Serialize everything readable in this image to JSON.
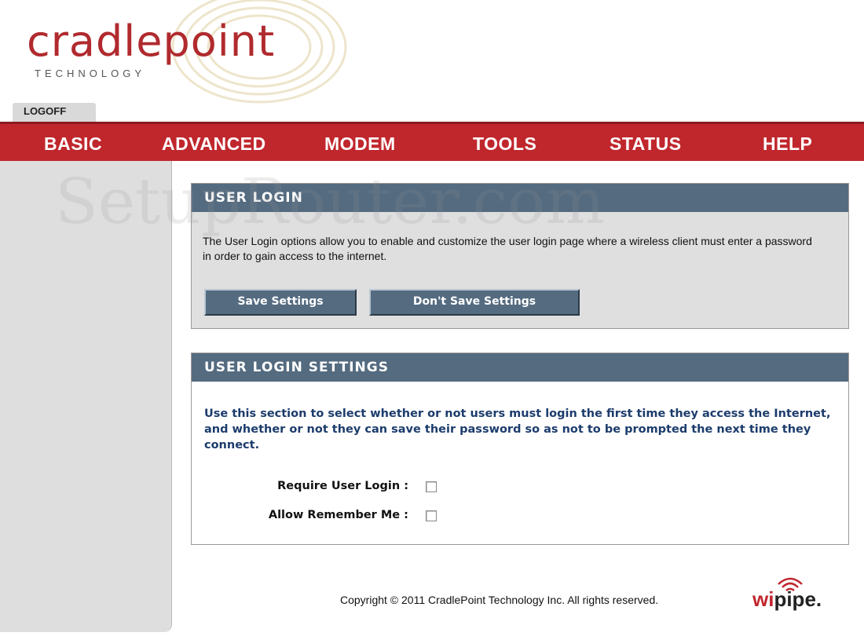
{
  "brand": {
    "name": "cradlepoint",
    "subtitle": "TECHNOLOGY",
    "accent_color": "#c0272d",
    "watermark": "SetupRouter.com"
  },
  "top_tabs": {
    "logoff": "LOGOFF"
  },
  "nav": {
    "items": [
      "BASIC",
      "ADVANCED",
      "MODEM",
      "TOOLS",
      "STATUS",
      "HELP"
    ]
  },
  "user_login": {
    "title": "USER LOGIN",
    "description": "The User Login options allow you to enable and customize the user login page where a wireless client must enter a password in order to gain access to the internet.",
    "save_button": "Save Settings",
    "dont_save_button": "Don't Save Settings"
  },
  "user_login_settings": {
    "title": "USER LOGIN SETTINGS",
    "description": "Use this section to select whether or not users must login the first time they access the Internet, and whether or not they can save their password so as not to be prompted the next time they connect.",
    "fields": [
      {
        "label": "Require User Login :",
        "checked": false
      },
      {
        "label": "Allow Remember Me :",
        "checked": false
      }
    ]
  },
  "footer": {
    "copyright": "Copyright © 2011 CradlePoint Technology Inc. All rights reserved.",
    "partner_logo_w": "wi",
    "partner_logo_rest": "pipe",
    "partner_logo_dot": "."
  }
}
